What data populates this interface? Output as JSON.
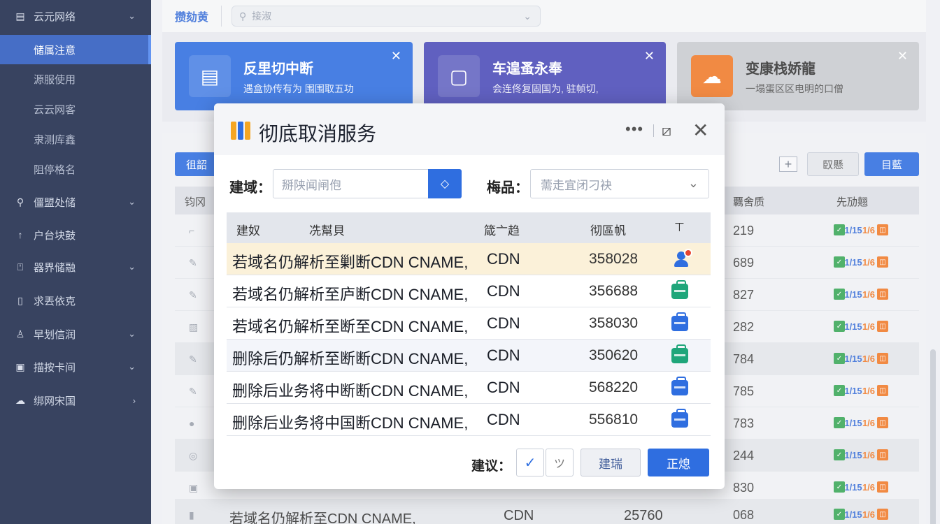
{
  "sidebar": {
    "header": "云元网络",
    "sub_items": [
      "储属注意",
      "源服使用",
      "云云网客",
      "隶测库鑫",
      "阻停格名"
    ],
    "items": [
      {
        "label": "僵盟处储",
        "icon": "search-icon",
        "chevron": "⌄"
      },
      {
        "label": "户台块鼓",
        "icon": "arrow-up-icon",
        "chevron": ""
      },
      {
        "label": "器界储融",
        "icon": "lock-icon",
        "chevron": "⌄"
      },
      {
        "label": "求丟依克",
        "icon": "document-icon",
        "chevron": ""
      },
      {
        "label": "早划信润",
        "icon": "user-icon",
        "chevron": "⌄"
      },
      {
        "label": "描按卡间",
        "icon": "briefcase-icon",
        "chevron": "⌄"
      },
      {
        "label": "绑网宋国",
        "icon": "cloud-icon",
        "chevron": "›"
      }
    ]
  },
  "topbar": {
    "title": "攒劾黄",
    "search_placeholder": "接淑"
  },
  "cards": [
    {
      "title": "反里切中断",
      "desc": "遇盒协传有为 围围取五功",
      "color": "#2f6ee0",
      "icon": "storage-icon"
    },
    {
      "title": "车遑蚤永奉",
      "desc": "会连佟复固国为, 驻帧切,",
      "color": "#4a4bb8",
      "icon": "screen-icon"
    },
    {
      "title": "变康栈娇龍",
      "desc": "一塌蛋区区电明的口僧",
      "color": "#bfc1c6",
      "icon": "cloud-icon"
    }
  ],
  "list": {
    "left_button": "徂韶",
    "gray_button": "臤懸",
    "blue_button": "目藍",
    "headers": {
      "c1": "钧冈",
      "c2": "覊舍质",
      "c3": "先劢翹"
    },
    "rows": [
      {
        "num": "219"
      },
      {
        "num": "689"
      },
      {
        "num": "827"
      },
      {
        "num": "282"
      },
      {
        "num": "784"
      },
      {
        "num": "785"
      },
      {
        "num": "783"
      },
      {
        "num": "244"
      },
      {
        "num": "830"
      }
    ],
    "last_row": {
      "text": "若域名仍解析至CDN CNAME,",
      "cdn": "CDN",
      "n2": "25760",
      "num": "068"
    },
    "tags": {
      "t1": "✓",
      "t2": "1/15",
      "t3": "1/6",
      "t4": "◫"
    }
  },
  "modal": {
    "title": "彻底取消服务",
    "more": "•••",
    "edit_icon": "⧄",
    "close": "✕",
    "field1_label": "建域：",
    "field1_placeholder": "掰陕闻闸佨",
    "field1_button": "◇",
    "field2_label": "梅品：",
    "field2_placeholder": "薷走宜闭刁袂",
    "table_headers": {
      "h1": "建奴",
      "h2": "冼幫貝",
      "h3": "箴亠趋",
      "h4": "彻區帆",
      "h5": "⊤"
    },
    "rows": [
      {
        "text": "若域名仍解析至剿断CDN CNAME,",
        "cdn": "CDN",
        "num": "358028",
        "icon": "user-alert-icon",
        "icon_color": "#2f6ee0",
        "highlight": true
      },
      {
        "text": "若域名仍解析至庐断CDN CNAME,",
        "cdn": "CDN",
        "num": "356688",
        "icon": "briefcase-icon",
        "icon_color": "#1fa67a",
        "highlight": false
      },
      {
        "text": "若域名仍解析至断至CDN CNAME,",
        "cdn": "CDN",
        "num": "358030",
        "icon": "briefcase-icon",
        "icon_color": "#2f6ee0",
        "highlight": false
      },
      {
        "text": "删除后仍解析至断断CDN CNAME,",
        "cdn": "CDN",
        "num": "350620",
        "icon": "briefcase-icon",
        "icon_color": "#1fa67a",
        "highlight": false
      },
      {
        "text": "删除后业务将中断断CDN CNAME,",
        "cdn": "CDN",
        "num": "568220",
        "icon": "briefcase-icon",
        "icon_color": "#2f6ee0",
        "highlight": false
      },
      {
        "text": "删除后业务将中国断CDN CNAME,",
        "cdn": "CDN",
        "num": "556810",
        "icon": "briefcase-icon",
        "icon_color": "#2f6ee0",
        "highlight": false
      }
    ],
    "footer_label": "建议：",
    "check1": "✓",
    "check2": "ツ",
    "gray_button": "建瑞",
    "blue_button": "正熄"
  }
}
